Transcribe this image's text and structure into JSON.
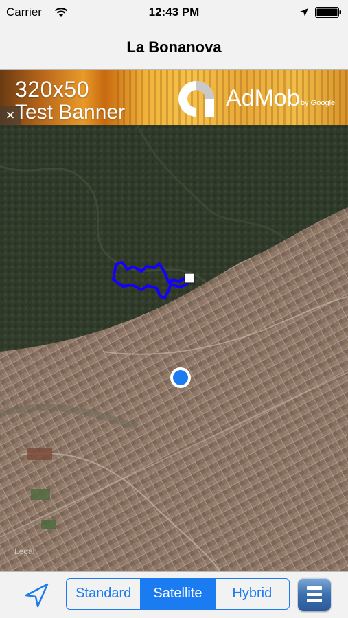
{
  "status_bar": {
    "carrier": "Carrier",
    "time": "12:43 PM"
  },
  "nav": {
    "title": "La Bonanova"
  },
  "ad": {
    "line1": "320x50",
    "line2": "Test Banner",
    "brand": "AdMob",
    "brand_suffix": "by Google",
    "close": "×"
  },
  "map": {
    "mode": "Satellite",
    "legal": "Legal",
    "route_color": "#1500ff",
    "user_location_color": "#1a7cf0"
  },
  "toolbar": {
    "segments": [
      {
        "label": "Standard",
        "selected": false
      },
      {
        "label": "Satellite",
        "selected": true
      },
      {
        "label": "Hybrid",
        "selected": false
      }
    ],
    "tracking_icon": "location-arrow-icon",
    "menu_icon": "hamburger-menu-icon"
  },
  "colors": {
    "accent": "#1a7cf0",
    "bar_background": "#f2f2f2"
  }
}
